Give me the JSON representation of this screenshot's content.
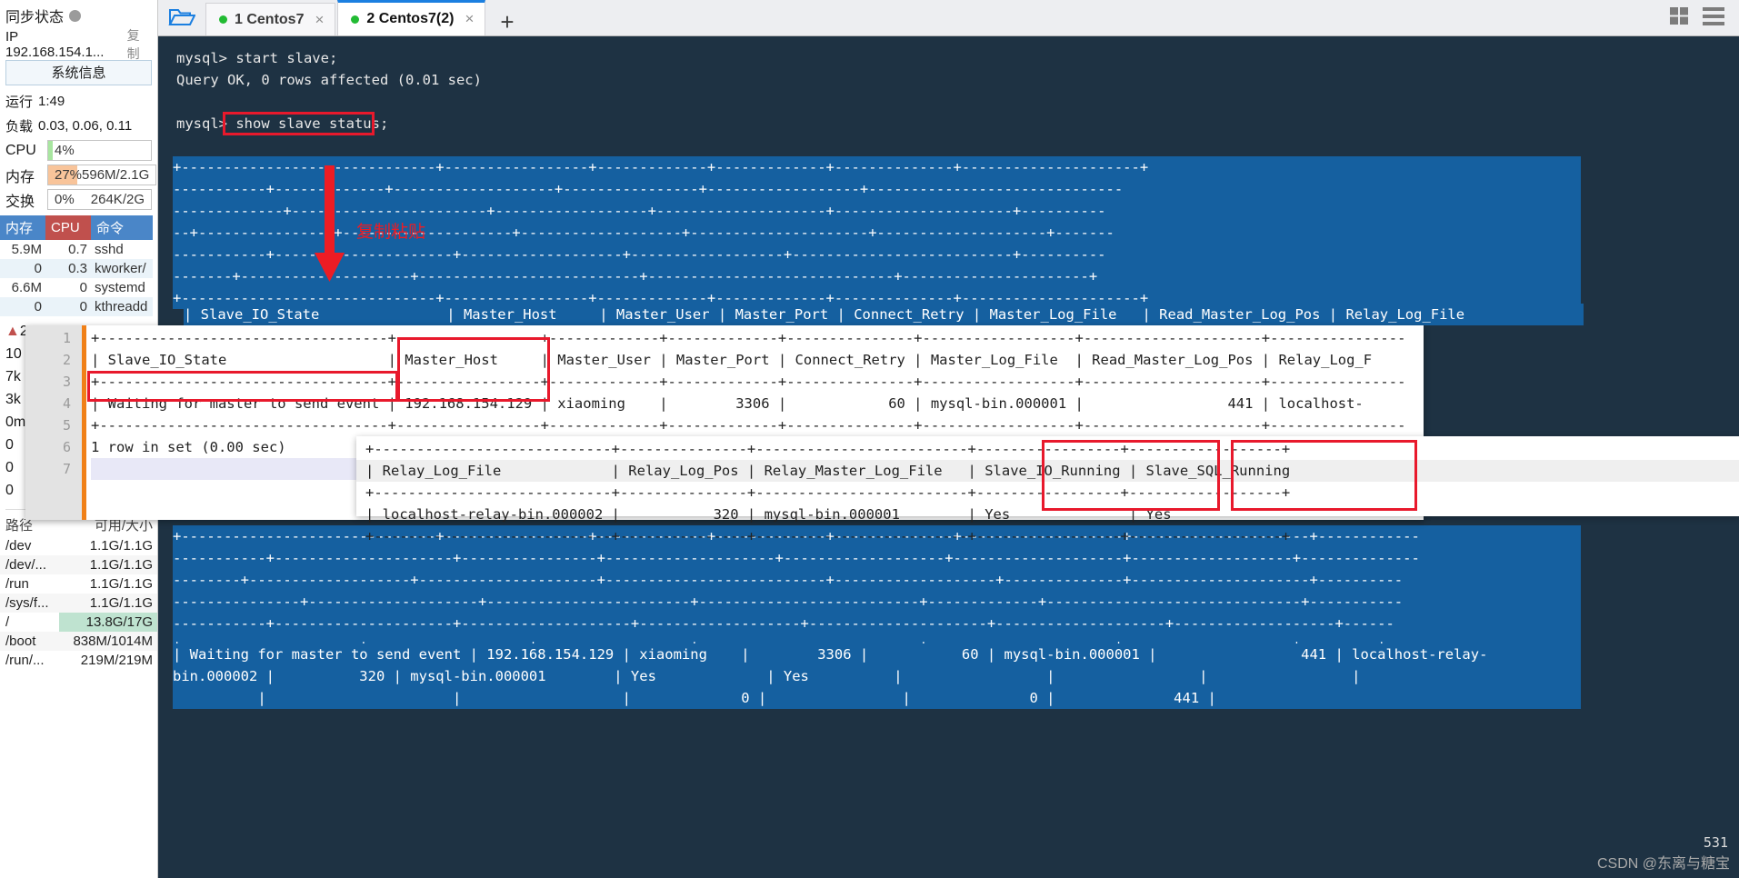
{
  "sidebar": {
    "sync_status_label": "同步状态",
    "ip_label": "IP 192.168.154.1...",
    "copy_label": "复制",
    "sysinfo_button": "系统信息",
    "uptime_label": "运行",
    "uptime_value": "1:49",
    "load_label": "负载",
    "load_value": "0.03, 0.06, 0.11",
    "cpu_label": "CPU",
    "cpu_value": "4%",
    "cpu_percent": 4,
    "cpu_color": "#a8e6a0",
    "mem_label": "内存",
    "mem_value": "27%",
    "mem_detail": "596M/2.1G",
    "mem_percent": 27,
    "mem_color": "#f8c49a",
    "swap_label": "交换",
    "swap_value": "0%",
    "swap_detail": "264K/2G",
    "swap_percent": 0,
    "proc_headers": [
      "内存",
      "CPU",
      "命令"
    ],
    "proc_header_mem_color": "#4a86c8",
    "proc_header_cpu_color": "#c0504d",
    "proc_rows": [
      {
        "mem": "5.9M",
        "cpu": "0.7",
        "cmd": "sshd"
      },
      {
        "mem": "0",
        "cpu": "0.3",
        "cmd": "kworker/"
      },
      {
        "mem": "6.6M",
        "cpu": "0",
        "cmd": "systemd"
      },
      {
        "mem": "0",
        "cpu": "0",
        "cmd": "kthreadd"
      }
    ],
    "net_rows": [
      {
        "icon": "▲",
        "value": "2"
      },
      {
        "icon": "",
        "value": "10"
      },
      {
        "icon": "",
        "value": "7k"
      },
      {
        "icon": "",
        "value": "3k"
      },
      {
        "icon": "",
        "value": "0m"
      },
      {
        "icon": "",
        "value": "0"
      },
      {
        "icon": "",
        "value": "0"
      },
      {
        "icon": "",
        "value": "0"
      }
    ],
    "disk_headers": [
      "路径",
      "可用/大小"
    ],
    "disk_rows": [
      {
        "path": "/dev",
        "size": "1.1G/1.1G",
        "hl": false
      },
      {
        "path": "/dev/...",
        "size": "1.1G/1.1G",
        "hl": false
      },
      {
        "path": "/run",
        "size": "1.1G/1.1G",
        "hl": false
      },
      {
        "path": "/sys/f...",
        "size": "1.1G/1.1G",
        "hl": false
      },
      {
        "path": "/",
        "size": "13.8G/17G",
        "hl": true
      },
      {
        "path": "/boot",
        "size": "838M/1014M",
        "hl": true
      },
      {
        "path": "/run/...",
        "size": "219M/219M",
        "hl": false
      }
    ]
  },
  "tabbar": {
    "folder_icon": "folder-open-icon",
    "tabs": [
      {
        "label": "1 Centos7",
        "status": "connected",
        "close": "×",
        "active": false
      },
      {
        "label": "2 Centos7(2)",
        "status": "connected",
        "close": "×",
        "active": true
      }
    ],
    "new_tab": "+",
    "grid_icon": "grid-view-icon",
    "menu_icon": "hamburger-menu-icon"
  },
  "terminal": {
    "prompt_lines": [
      "mysql> start slave;",
      "Query OK, 0 rows affected (0.01 sec)",
      "",
      "mysql> show slave status;"
    ],
    "selected_lines": [
      "+------------------------------+-----------------+-------------+-------------+--------------+---------------------+",
      "-----------+-------------+-------------------+----------------+------------------+------------------------------",
      "-------------+-----------------------+------------------+--------------------+---------------------+----------",
      "--+----------------+--------------------+-------------------+---------------------+--------------------+-------",
      "-----------+---------------------+-------------------+------------------+--------------------------+----------",
      "-------+--------------------+--------------------------+-----------------------------+----------------------+",
      "+------------------------------+-----------------+-------------+-------------+--------------+---------------------+"
    ],
    "header_row": "| Slave_IO_State               | Master_Host     | Master_User | Master_Port | Connect_Retry | Master_Log_File   | Read_Master_Log_Pos | Relay_Log_File",
    "bottom_lines": [
      "+------------------------------+-----------------+-------------+-------------+--------------+-------------------+---------------------+------------",
      "-----------+---------------------+----------------+--------------------+-------------------+--------------------+-------------------+--------------",
      "--------+-------------------+---------------------+--------------------------+-------------------+--------------+---------------------+----------",
      "---------------+--------------------+------------------------+--------------------------+-------------+------------------------------+-----------",
      "-----------+---------------------+--------------------+-------------------+---------------------+--------------------+-------------------+------",
      "+---------------------+-------------------+------------------+--------------------------+----------------------+--------------------+---------+"
    ],
    "result_row_1": "| Waiting for master to send event | 192.168.154.129 | xiaoming    |        3306 |           60 | mysql-bin.000001 |                 441 | localhost-relay-",
    "result_row_2": "bin.000002 |          320 | mysql-bin.000001        | Yes             | Yes          |                 |                 |                 |",
    "result_row_3": "          |                      |                   |             0 |                |              0 |              441 |",
    "annotation_text": "复制粘贴",
    "annotation_color": "#ed1c24",
    "selection_bg": "#1560a0",
    "background": "#1e3243"
  },
  "paste_panel_1": {
    "line_numbers": [
      "1",
      "2",
      "3",
      "4",
      "5",
      "6",
      "7"
    ],
    "lines": [
      "+----------------------------------+-----------------+-------------+-------------+---------------+------------------+---------------------+----------------",
      "| Slave_IO_State                   | Master_Host     | Master_User | Master_Port | Connect_Retry | Master_Log_File  | Read_Master_Log_Pos | Relay_Log_F",
      "+----------------------------------+-----------------+-------------+-------------+---------------+------------------+---------------------+----------------",
      "| Waiting for master to send event | 192.168.154.129 | xiaoming    |        3306 |            60 | mysql-bin.000001 |                 441 | localhost-",
      "+----------------------------------+-----------------+-------------+-------------+---------------+------------------+---------------------+----------------",
      "1 row in set (0.00 sec)",
      ""
    ]
  },
  "paste_panel_2": {
    "lines": [
      "+----------------------------+---------------+-------------------------+-----------------+------------------+",
      "| Relay_Log_File             | Relay_Log_Pos | Relay_Master_Log_File   | Slave_IO_Running | Slave_SQL_Running",
      "+----------------------------+---------------+-------------------------+-----------------+------------------+",
      "| localhost-relay-bin.000002 |           320 | mysql-bin.000001        | Yes              | Yes",
      "+----------------------------+---------------+-------------------------+-----------------+------------------+"
    ]
  },
  "highlight_boxes": [
    {
      "name": "show-slave-status-highlight"
    },
    {
      "name": "waiting-for-master-highlight"
    },
    {
      "name": "master-host-header-highlight"
    },
    {
      "name": "master-host-value-highlight"
    },
    {
      "name": "slave-io-running-highlight"
    },
    {
      "name": "slave-sql-running-highlight"
    }
  ],
  "footer": {
    "watermark": "CSDN @东离与糖宝",
    "corner_number": "531"
  }
}
